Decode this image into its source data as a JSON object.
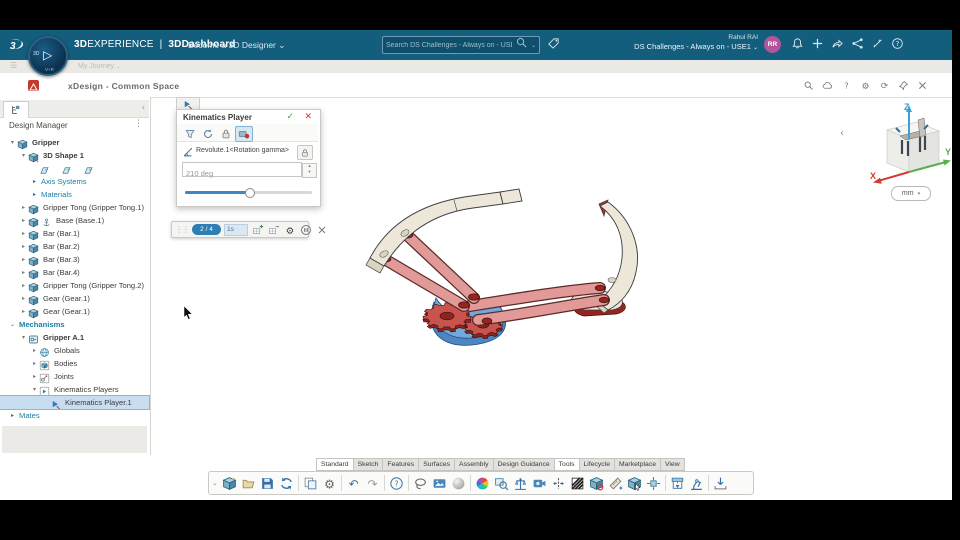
{
  "topbar": {
    "brand_bold": "3D",
    "brand_light": "EXPERIENCE",
    "brand_divider": "|",
    "brand_app": "3DDashboard",
    "promo": "Become a 3D Designer",
    "promo_chevron": "⌄",
    "search": {
      "placeholder": "Search DS Challenges - Always on - USE1"
    },
    "user": {
      "name": "Rahul RAI",
      "tenant": "DS Challenges - Always on - USE1",
      "avatar_initials": "RR"
    },
    "icons": [
      "notifications",
      "add",
      "reply",
      "share",
      "whats-new",
      "help-circle"
    ]
  },
  "dashboard_bar": {
    "tab": "My Journey"
  },
  "titlebar": {
    "title": "xDesign - Common Space",
    "icons": [
      "search",
      "cloud",
      "help",
      "settings",
      "refresh",
      "pin",
      "close"
    ]
  },
  "design_manager": {
    "header": "Design Manager",
    "tree": [
      {
        "label": "Gripper",
        "level": 0,
        "arrow": "expanded",
        "icon": "part",
        "bold": true
      },
      {
        "label": "3D Shape 1",
        "level": 1,
        "arrow": "expanded",
        "icon": "shape",
        "bold": true
      },
      {
        "type": "planes",
        "level": 2,
        "icons": [
          "plane",
          "plane",
          "plane"
        ]
      },
      {
        "label": "Axis Systems",
        "level": 2,
        "arrow": "collapsed",
        "accent": true
      },
      {
        "label": "Materials",
        "level": 2,
        "arrow": "collapsed",
        "accent": true
      },
      {
        "label": "Gripper Tong (Gripper Tong.1)",
        "level": 1,
        "arrow": "collapsed",
        "icon": "part"
      },
      {
        "label": "Base (Base.1)",
        "level": 1,
        "arrow": "collapsed",
        "icon": "part",
        "extra": "anchor"
      },
      {
        "label": "Bar (Bar.1)",
        "level": 1,
        "arrow": "collapsed",
        "icon": "part"
      },
      {
        "label": "Bar (Bar.2)",
        "level": 1,
        "arrow": "collapsed",
        "icon": "part"
      },
      {
        "label": "Bar (Bar.3)",
        "level": 1,
        "arrow": "collapsed",
        "icon": "part"
      },
      {
        "label": "Bar (Bar.4)",
        "level": 1,
        "arrow": "collapsed",
        "icon": "part"
      },
      {
        "label": "Gripper Tong (Gripper Tong.2)",
        "level": 1,
        "arrow": "collapsed",
        "icon": "part"
      },
      {
        "label": "Gear (Gear.1)",
        "level": 1,
        "arrow": "collapsed",
        "icon": "part"
      },
      {
        "label": "Gear (Gear.1)",
        "level": 1,
        "arrow": "collapsed",
        "icon": "part"
      },
      {
        "label": "Mechanisms",
        "level": 0,
        "arrow": "expanded",
        "accent": true,
        "bold": true
      },
      {
        "label": "Gripper A.1",
        "level": 1,
        "arrow": "expanded",
        "icon": "mechanism",
        "bold": true
      },
      {
        "label": "Globals",
        "level": 2,
        "arrow": "collapsed",
        "icon": "globe"
      },
      {
        "label": "Bodies",
        "level": 2,
        "arrow": "collapsed",
        "icon": "bodies"
      },
      {
        "label": "Joints",
        "level": 2,
        "arrow": "collapsed",
        "icon": "joints"
      },
      {
        "label": "Kinematics Players",
        "level": 2,
        "arrow": "expanded",
        "icon": "kin-players"
      },
      {
        "label": "Kinematics Player.1",
        "level": 3,
        "icon": "kin-player",
        "selected": true
      },
      {
        "label": "Mates",
        "level": 0,
        "arrow": "collapsed",
        "accent": true
      }
    ]
  },
  "dialog": {
    "title": "Kinematics Player",
    "ok": "✓",
    "close": "✕",
    "toolbar": [
      "filter",
      "reset",
      "lock",
      "record"
    ],
    "active_tool": "record",
    "command_label": "Revolute.1<Rotation gamma>",
    "value": "210 deg",
    "slider_percent": 50
  },
  "player_bar": {
    "counter": "2 / 4",
    "duration": "1s",
    "icons": [
      "add-frame",
      "remove-frame",
      "gear",
      "pause-circle",
      "close-x"
    ]
  },
  "action_bar": {
    "tabs": [
      "Standard",
      "Sketch",
      "Features",
      "Surfaces",
      "Assembly",
      "Design Guidance",
      "Tools",
      "Lifecycle",
      "Marketplace",
      "View"
    ],
    "raised_tabs": [
      "Standard",
      "Tools"
    ],
    "active_tab": "Tools",
    "icons": [
      "new-part",
      "open",
      "save",
      "sync",
      "duplicate",
      "gear-tool",
      "undo",
      "redo",
      "help-tool",
      "lasso-select",
      "screenshot",
      "shaded-sphere",
      "color-wheel",
      "preview",
      "mass-properties",
      "camera-view",
      "section",
      "draft-analysis",
      "clash-check",
      "measure",
      "manipulate",
      "exploded-view",
      "print-3d",
      "robot",
      "download"
    ],
    "separators_after": [
      3,
      5,
      7,
      8,
      11,
      21,
      23
    ]
  },
  "viewport": {
    "units": "mm",
    "axes": {
      "x": "X",
      "y": "Y",
      "z": "Z"
    },
    "nav_left": "‹",
    "collapse": "‹"
  },
  "colors": {
    "topbar_teal": "#135e7d",
    "accent_blue": "#2e7db3",
    "tree_accent": "#1a7fa6",
    "selection": "#c8ddef",
    "check_green": "#3fa33f",
    "close_red": "#d0342c",
    "record_red": "#c0392b",
    "model": {
      "cream": "#ece7d9",
      "cream_dark": "#d9d3c1",
      "salmon": "#e29a98",
      "salmon_dark": "#5a2a28",
      "red_dark": "#97251f",
      "gear_red": "#c9544e",
      "base_blue": "#70a9de",
      "base_blue_dark": "#4d86c0",
      "outline": "#3c3c3c"
    }
  }
}
